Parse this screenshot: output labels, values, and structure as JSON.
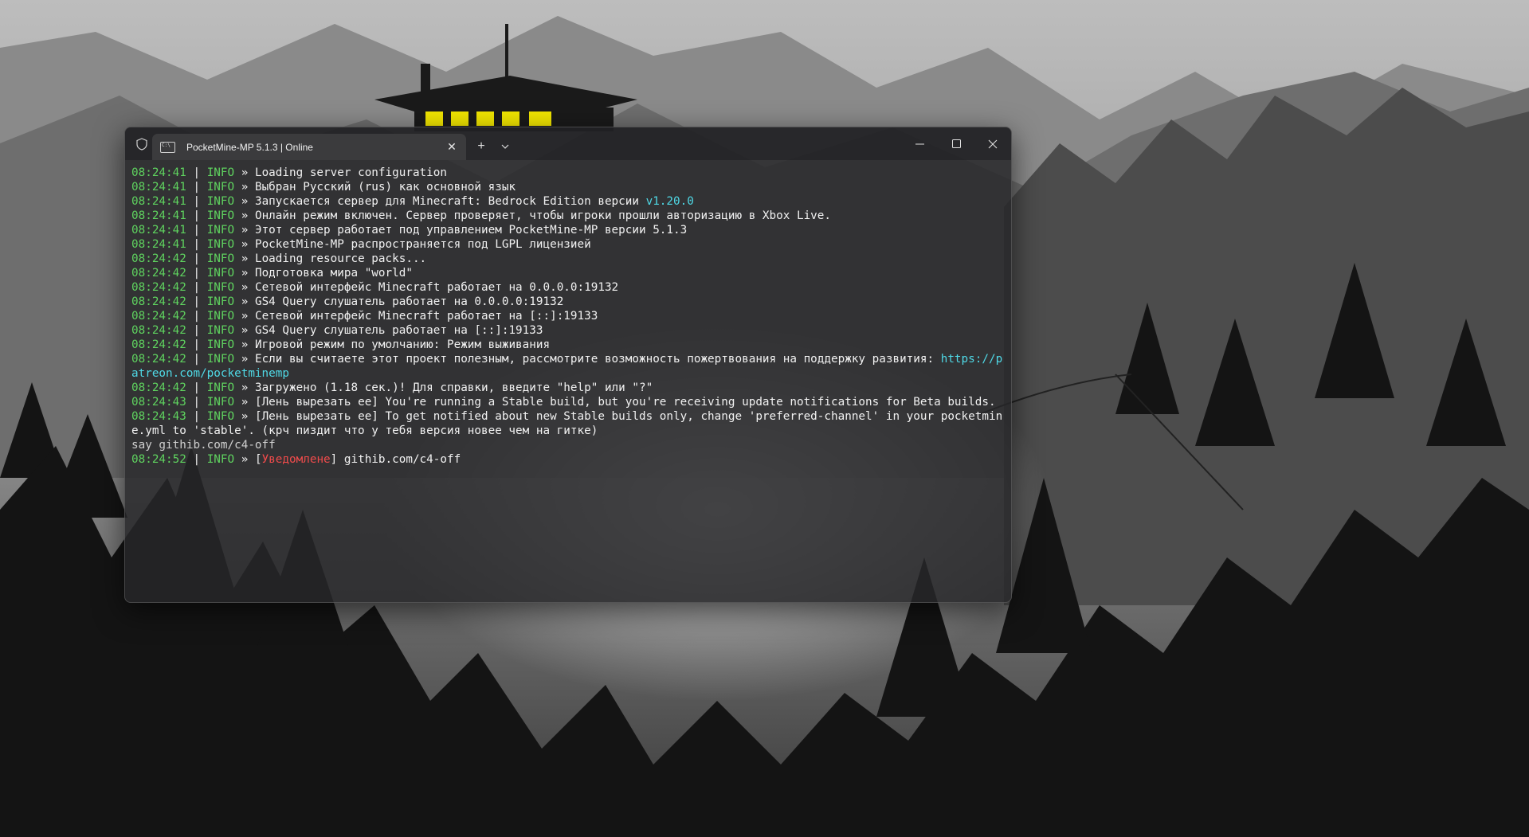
{
  "window": {
    "tab_title": "PocketMine-MP 5.1.3 | Online",
    "tab_close_glyph": "✕",
    "new_tab_glyph": "+"
  },
  "colors": {
    "timestamp": "#5fd35f",
    "info": "#5fd35f",
    "link": "#4fd9e6",
    "notice": "#f04b4b"
  },
  "console": {
    "lines": [
      {
        "time": "08:24:41",
        "level": "INFO",
        "message": "Loading server configuration"
      },
      {
        "time": "08:24:41",
        "level": "INFO",
        "message": "Выбран Русский (rus) как основной язык"
      },
      {
        "time": "08:24:41",
        "level": "INFO",
        "message": "Запускается сервер для Minecraft: Bedrock Edition версии ",
        "highlight": "v1.20.0"
      },
      {
        "time": "08:24:41",
        "level": "INFO",
        "message": "Онлайн режим включен. Сервер проверяет, чтобы игроки прошли авторизацию в Xbox Live."
      },
      {
        "time": "08:24:41",
        "level": "INFO",
        "message": "Этот сервер работает под управлением PocketMine-MP версии 5.1.3"
      },
      {
        "time": "08:24:41",
        "level": "INFO",
        "message": "PocketMine-MP распространяется под LGPL лицензией"
      },
      {
        "time": "08:24:42",
        "level": "INFO",
        "message": "Loading resource packs..."
      },
      {
        "time": "08:24:42",
        "level": "INFO",
        "message": "Подготовка мира \"world\""
      },
      {
        "time": "08:24:42",
        "level": "INFO",
        "message": "Сетевой интерфейс Minecraft работает на 0.0.0.0:19132"
      },
      {
        "time": "08:24:42",
        "level": "INFO",
        "message": "GS4 Query слушатель работает на 0.0.0.0:19132"
      },
      {
        "time": "08:24:42",
        "level": "INFO",
        "message": "Сетевой интерфейс Minecraft работает на [::]:19133"
      },
      {
        "time": "08:24:42",
        "level": "INFO",
        "message": "GS4 Query слушатель работает на [::]:19133"
      },
      {
        "time": "08:24:42",
        "level": "INFO",
        "message": "Игровой режим по умолчанию: Режим выживания"
      },
      {
        "time": "08:24:42",
        "level": "INFO",
        "message": "Если вы считаете этот проект полезным, рассмотрите возможность пожертвования на поддержку развития: ",
        "highlight": "https://patreon.com/pocketminemp"
      },
      {
        "time": "08:24:42",
        "level": "INFO",
        "message": "Загружено (1.18 сек.)! Для справки, введите \"help\" или \"?\""
      },
      {
        "time": "08:24:43",
        "level": "INFO",
        "message": "[Лень вырезать ее] You're running a Stable build, but you're receiving update notifications for Beta builds."
      },
      {
        "time": "08:24:43",
        "level": "INFO",
        "message": "[Лень вырезать ее] To get notified about new Stable builds only, change 'preferred-channel' in your pocketmine.yml to 'stable'. (крч пиздит что у тебя версия новее чем на гитке)"
      },
      {
        "plain": "say githib.com/c4-off"
      },
      {
        "time": "08:24:52",
        "level": "INFO",
        "message": "[",
        "notice": "Уведомлене",
        "suffix": "] githib.com/c4-off"
      }
    ]
  }
}
